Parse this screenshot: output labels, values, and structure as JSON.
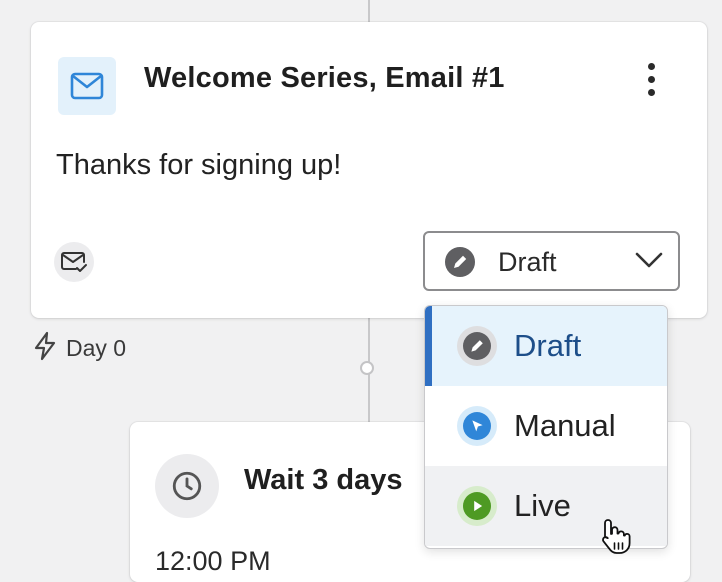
{
  "email_card": {
    "title": "Welcome Series, Email #1",
    "body": "Thanks for signing up!",
    "icon": "envelope-icon",
    "footer_icon": "envelope-check-icon",
    "menu_icon": "kebab-menu-icon",
    "status": {
      "selected_label": "Draft",
      "icon": "pencil-icon",
      "chevron": "chevron-down-icon"
    }
  },
  "trigger": {
    "icon": "lightning-icon",
    "label": "Day 0"
  },
  "wait_card": {
    "icon": "clock-icon",
    "title": "Wait 3 days",
    "time": "12:00 PM"
  },
  "status_dropdown": {
    "options": [
      {
        "label": "Draft",
        "icon": "pencil-icon",
        "selected": true
      },
      {
        "label": "Manual",
        "icon": "cursor-click-icon",
        "selected": false
      },
      {
        "label": "Live",
        "icon": "play-icon",
        "selected": false
      }
    ]
  },
  "colors": {
    "accent_blue": "#2f6fc2",
    "draft_text": "#1d4e89",
    "live_green": "#4e9a23",
    "manual_blue": "#2f86d8",
    "email_icon_blue": "#2f86d8"
  }
}
